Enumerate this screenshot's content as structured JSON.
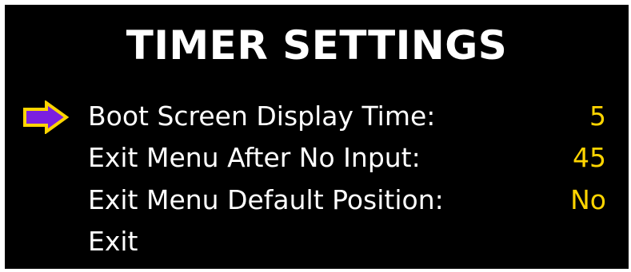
{
  "title": "TIMER SETTINGS",
  "colors": {
    "background": "#000000",
    "label": "#ffffff",
    "value": "#ffd500",
    "cursor_fill": "#7b1fe0",
    "cursor_outline": "#ffd500"
  },
  "cursor": {
    "icon": "arrow-right-icon",
    "selected_item_index": 0
  },
  "menu": {
    "items": [
      {
        "label": "Boot Screen Display Time:",
        "value": "5"
      },
      {
        "label": "Exit Menu After No Input:",
        "value": "45"
      },
      {
        "label": "Exit Menu Default Position:",
        "value": "No"
      },
      {
        "label": "Exit",
        "value": ""
      }
    ]
  }
}
